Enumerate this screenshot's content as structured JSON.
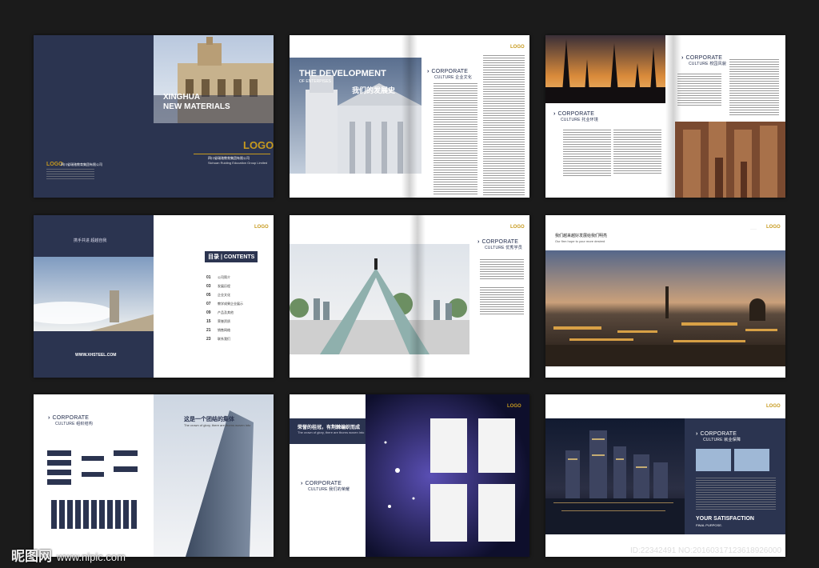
{
  "spread1": {
    "title_line1": "XINGHUA",
    "title_line2": "NEW MATERIALS",
    "logo": "LOGO",
    "company_cn": "四川省瑞驰教育集团有限公司",
    "company_en": "Sichuan Ruiding Education Group Limited",
    "footer_logo": "LOGO",
    "footer_company": "四川省瑞驰教育集团有限公司"
  },
  "spread2": {
    "title_line1": "THE  DEVELOPMENT",
    "title_line2": "OF ENTERPISES",
    "title_cn": "我们的发展史",
    "logo": "LOGO",
    "corporate": "CORPORATE",
    "culture": "CULTURE 企业文化"
  },
  "spread3": {
    "corporate_left": "CORPORATE",
    "culture_left": "CULTURE 托业环境",
    "corporate_right": "CORPORATE",
    "culture_right": "CULTURE 校园风貌"
  },
  "spread4": {
    "slogan_cn": "携手共进  超越自我",
    "website": "WWW.XHSTEEL.COM",
    "toc_title": "目录 | CONTENTS",
    "logo": "LOGO",
    "toc": [
      {
        "num": "01",
        "label": "公司简介"
      },
      {
        "num": "03",
        "label": "发展历程"
      },
      {
        "num": "05",
        "label": "企业文化"
      },
      {
        "num": "07",
        "label": "教学成果企业展示"
      },
      {
        "num": "09",
        "label": "产品及其他"
      },
      {
        "num": "15",
        "label": "荣誉资质"
      },
      {
        "num": "21",
        "label": "销售网络"
      },
      {
        "num": "23",
        "label": "联系我们"
      }
    ]
  },
  "spread5": {
    "logo": "LOGO",
    "corporate": "CORPORATE",
    "culture": "CULTURE 优秀学员"
  },
  "spread6": {
    "headline_cn": "我们越来越好发展给我们明亮",
    "subline": "Our firm hope to your more desired",
    "logo": "LOGO"
  },
  "spread7": {
    "corporate": "CORPORATE",
    "culture": "CULTURE 组织结构",
    "headline_cn": "这是一个团结的集体",
    "subline": "The crown of glory, there are thorns woven into"
  },
  "spread8": {
    "headline_cn": "荣誉的桂冠，有荆棘编织而成",
    "subline": "The crown of glory, there are thorns woven into",
    "corporate": "CORPORATE",
    "culture": "CULTURE 我们的荣耀",
    "logo": "LOGO"
  },
  "spread9": {
    "corporate": "CORPORATE",
    "culture": "CULTURE 就业保障",
    "tagline1": "YOUR SATISFACTION",
    "tagline2": "FINAL PURPOSE.",
    "logo": "LOGO"
  },
  "watermark": {
    "brand": "昵图网",
    "url": "www.nipic.com",
    "id": "ID:22342491 NO:20160317123618926000"
  },
  "colors": {
    "navy": "#2b3450",
    "gold": "#c79a1e",
    "background": "#1b1b1b"
  }
}
